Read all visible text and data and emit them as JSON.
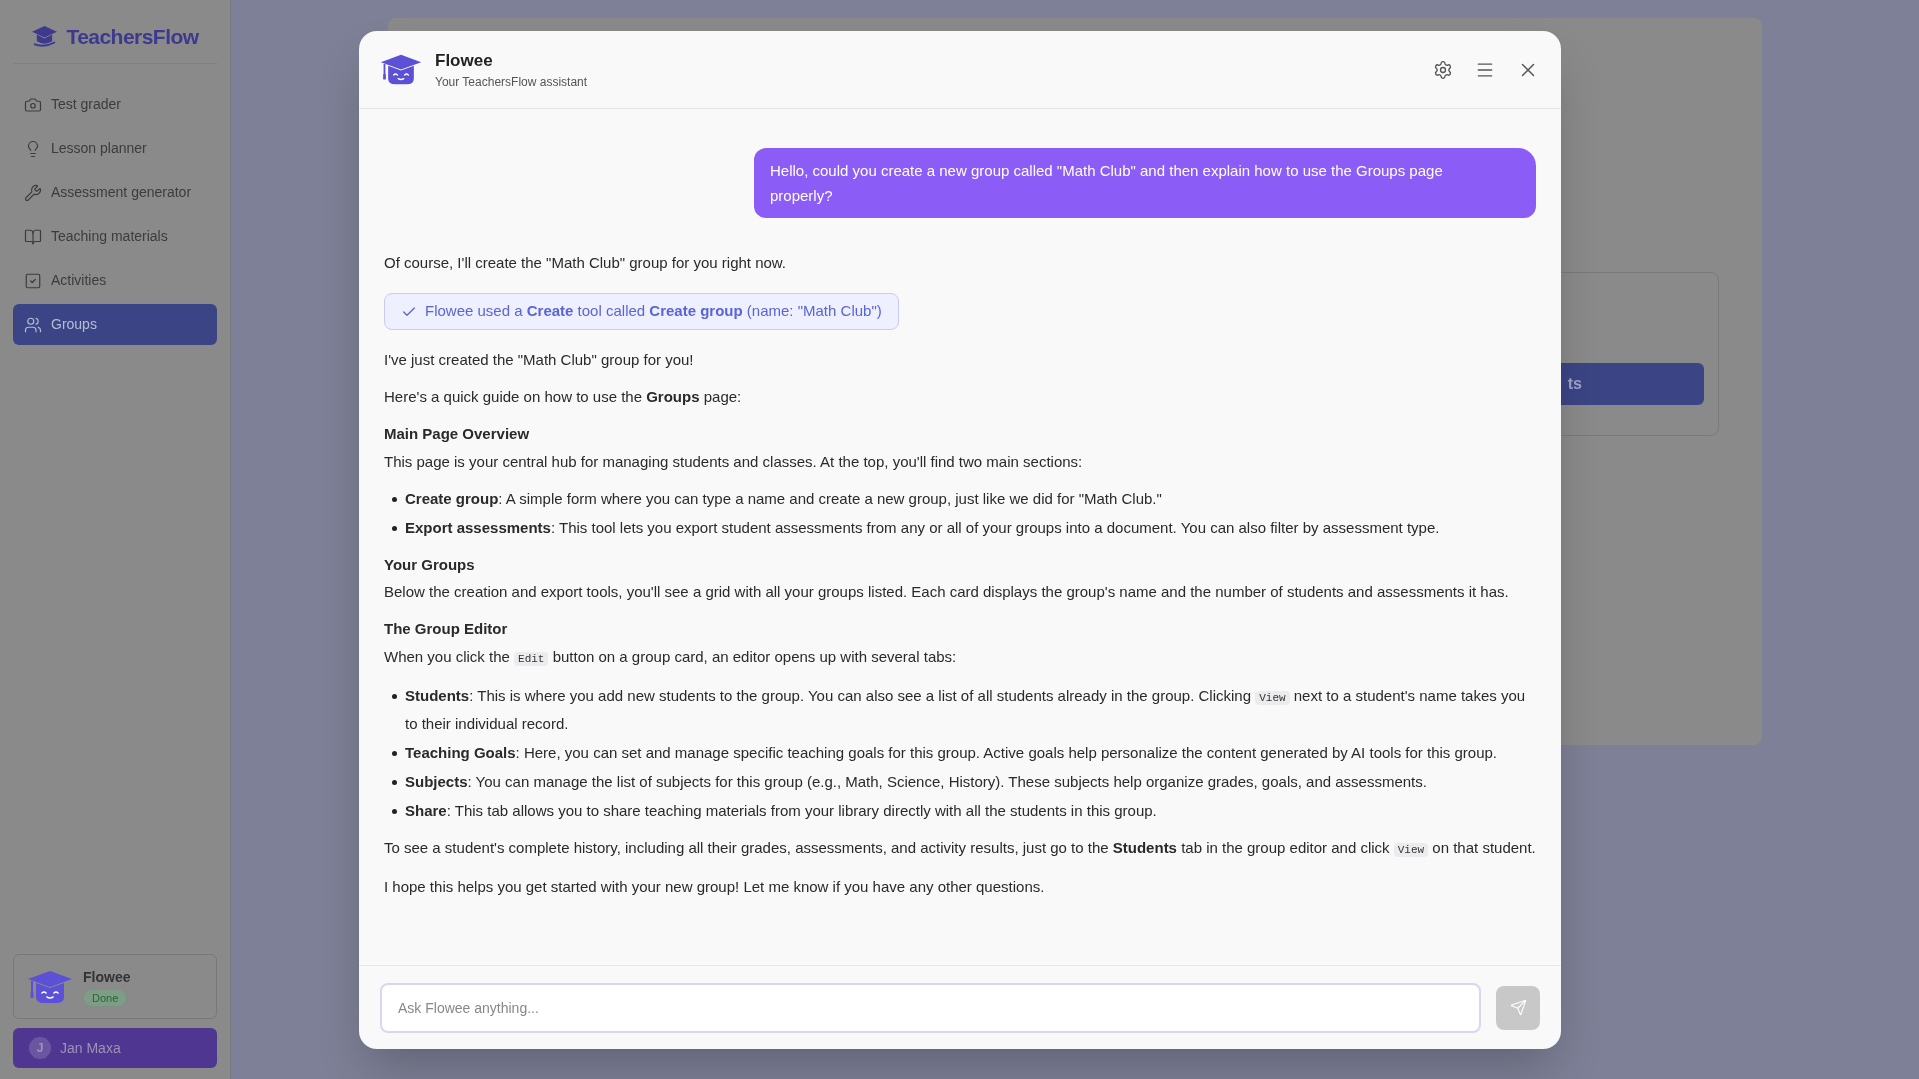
{
  "sidebar": {
    "brand": "TeachersFlow",
    "items": [
      {
        "label": "Test grader",
        "selected": false
      },
      {
        "label": "Lesson planner",
        "selected": false
      },
      {
        "label": "Assessment generator",
        "selected": false
      },
      {
        "label": "Teaching materials",
        "selected": false
      },
      {
        "label": "Activities",
        "selected": false
      },
      {
        "label": "Groups",
        "selected": true
      }
    ],
    "assistant_card": {
      "name": "Flowee",
      "status": "Done"
    },
    "user": {
      "initial": "J",
      "name": "Jan Maxa"
    }
  },
  "background": {
    "button_label": "ts"
  },
  "chat": {
    "title": "Flowee",
    "subtitle": "Your TeachersFlow assistant",
    "messages": [
      {
        "kind": "user",
        "text": "Hello, could you create a new group called \"Math Club\" and then explain how to use the Groups page properly?"
      },
      {
        "kind": "assistant",
        "blocks": [
          {
            "kind": "paragraph",
            "parts": [
              {
                "kind": "text",
                "text": "Of course, I'll create the \"Math Club\" group for you right now."
              }
            ]
          },
          {
            "kind": "tool",
            "text": "Flowee used a **Create** tool called **Create group** (name: \"Math Club\")"
          },
          {
            "kind": "paragraph",
            "parts": [
              {
                "kind": "text",
                "text": "I've just created the \"Math Club\" group for you!"
              }
            ]
          },
          {
            "kind": "paragraph",
            "parts": [
              {
                "kind": "text",
                "text": "Here's a quick guide on how to use the **Groups** page:"
              }
            ]
          },
          {
            "kind": "heading",
            "text": "Main Page Overview"
          },
          {
            "kind": "paragraph",
            "parts": [
              {
                "kind": "text",
                "text": "This page is your central hub for managing students and classes. At the top, you'll find two main sections:"
              }
            ]
          },
          {
            "kind": "bullets",
            "items": [
              [
                {
                  "kind": "text",
                  "text": "**Create group**: A simple form where you can type a name and create a new group, just like we did for \"Math Club.\""
                }
              ],
              [
                {
                  "kind": "text",
                  "text": "**Export assessments**: This tool lets you export student assessments from any or all of your groups into a document. You can also filter by assessment type."
                }
              ]
            ]
          },
          {
            "kind": "heading",
            "text": "Your Groups"
          },
          {
            "kind": "paragraph",
            "parts": [
              {
                "kind": "text",
                "text": "Below the creation and export tools, you'll see a grid with all your groups listed. Each card displays the group's name and the number of students and assessments it has."
              }
            ]
          },
          {
            "kind": "heading",
            "text": "The Group Editor"
          },
          {
            "kind": "paragraph",
            "parts": [
              {
                "kind": "text",
                "text": "When you click the "
              },
              {
                "kind": "code",
                "text": "Edit"
              },
              {
                "kind": "text",
                "text": " button on a group card, an editor opens up with several tabs:"
              }
            ]
          },
          {
            "kind": "bullets",
            "items": [
              [
                {
                  "kind": "text",
                  "text": "**Students**: This is where you add new students to the group. You can also see a list of all students already in the group. Clicking "
                },
                {
                  "kind": "code",
                  "text": "View"
                },
                {
                  "kind": "text",
                  "text": " next to a student's name takes you to their individual record."
                }
              ],
              [
                {
                  "kind": "text",
                  "text": "**Teaching Goals**: Here, you can set and manage specific teaching goals for this group. Active goals help personalize the content generated by AI tools for this group."
                }
              ],
              [
                {
                  "kind": "text",
                  "text": "**Subjects**: You can manage the list of subjects for this group (e.g., Math, Science, History). These subjects help organize grades, goals, and assessments."
                }
              ],
              [
                {
                  "kind": "text",
                  "text": "**Share**: This tab allows you to share teaching materials from your library directly with all the students in this group."
                }
              ]
            ]
          },
          {
            "kind": "paragraph",
            "parts": [
              {
                "kind": "text",
                "text": "To see a student's complete history, including all their grades, assessments, and activity results, just go to the **Students** tab in the group editor and click "
              },
              {
                "kind": "code",
                "text": "View"
              },
              {
                "kind": "text",
                "text": " on that student."
              }
            ]
          },
          {
            "kind": "paragraph",
            "parts": [
              {
                "kind": "text",
                "text": "I hope this helps you get started with your new group! Let me know if you have any other questions."
              }
            ]
          }
        ]
      }
    ],
    "input": {
      "placeholder": "Ask Flowee anything..."
    }
  }
}
